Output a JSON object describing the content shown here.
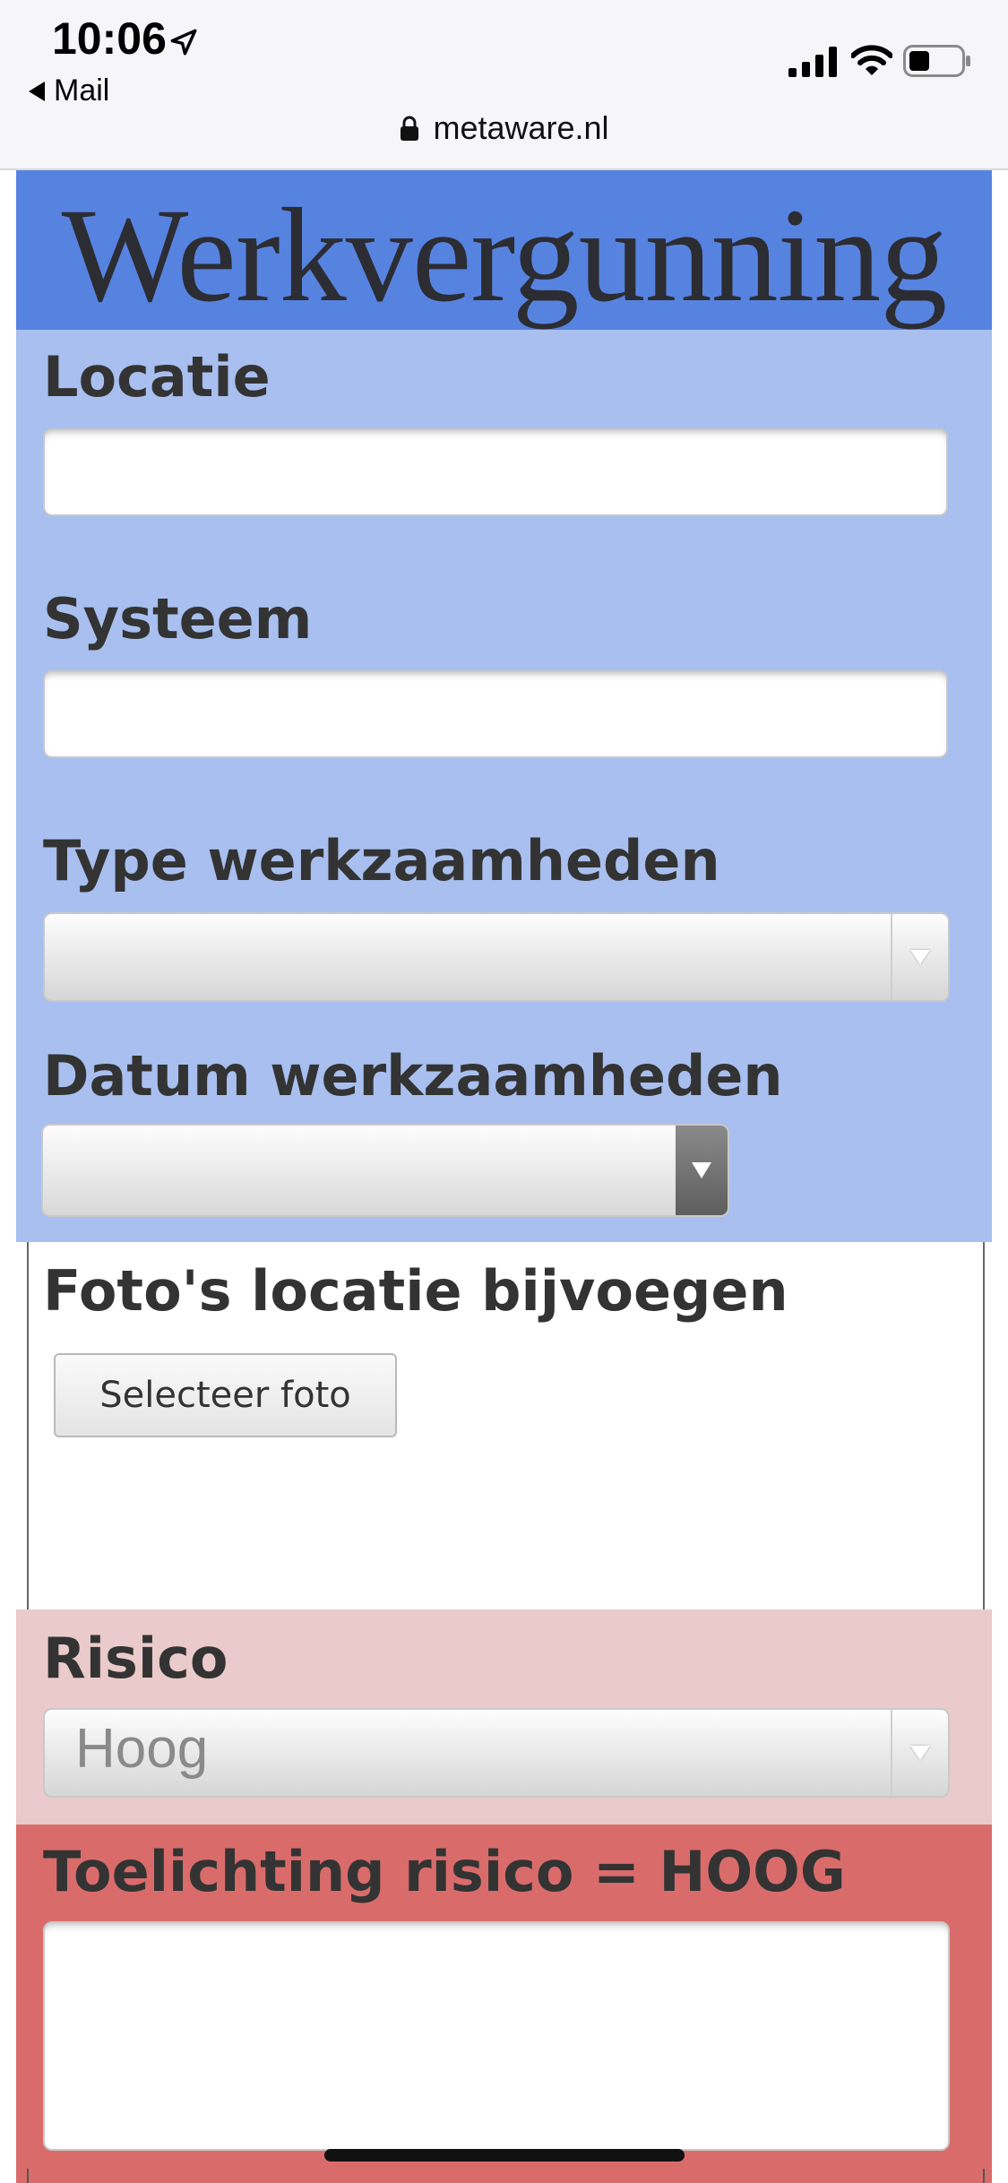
{
  "status_bar": {
    "time": "10:06",
    "back_app": "Mail",
    "signal_icon": "cellular-signal-icon",
    "wifi_icon": "wifi-icon",
    "battery_icon": "battery-icon"
  },
  "browser": {
    "url": "metaware.nl"
  },
  "page": {
    "title": "Werkvergunning"
  },
  "form": {
    "locatie_label": "Locatie",
    "locatie_value": "",
    "systeem_label": "Systeem",
    "systeem_value": "",
    "type_label": "Type werkzaamheden",
    "type_value": "",
    "datum_label": "Datum werkzaamheden",
    "datum_value": "",
    "foto_label": "Foto's locatie bijvoegen",
    "foto_button": "Selecteer foto",
    "risico_label": "Risico",
    "risico_value": "Hoog",
    "toelichting_label": "Toelichting risico = HOOG",
    "toelichting_value": ""
  },
  "colors": {
    "header_blue": "#5783e0",
    "panel_blue": "#a8bfef",
    "panel_pink": "#eacaca",
    "panel_red": "#d96c6b"
  }
}
